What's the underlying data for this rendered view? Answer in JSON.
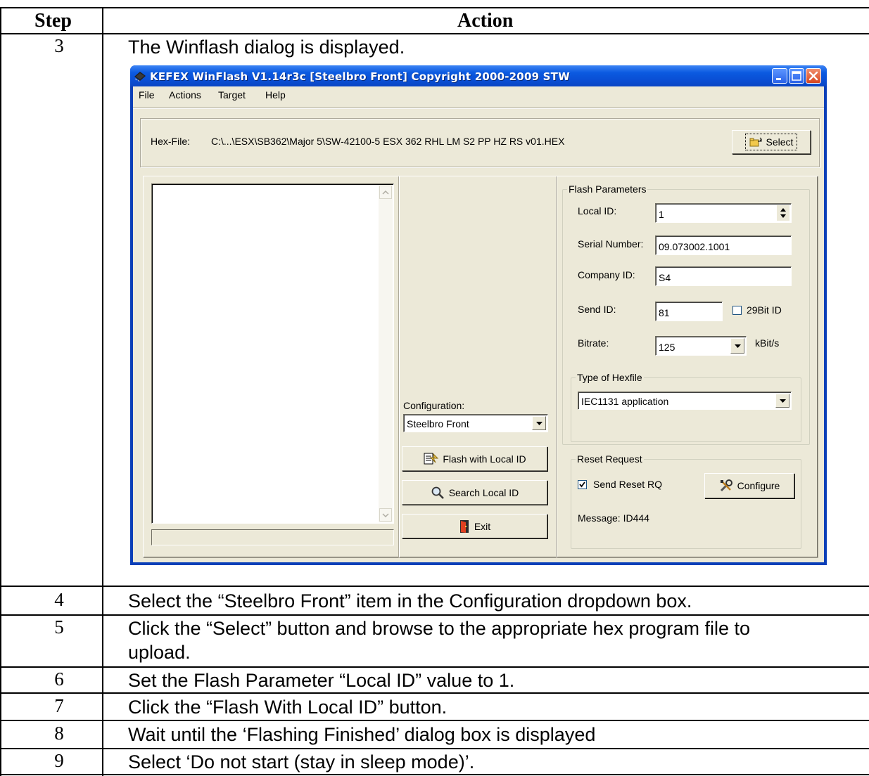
{
  "table": {
    "header": {
      "step": "Step",
      "action": "Action"
    },
    "rows": [
      {
        "step": "3",
        "action": "The Winflash dialog is displayed."
      },
      {
        "step": "4",
        "action": "Select the “Steelbro Front” item in the Configuration dropdown box."
      },
      {
        "step": "5",
        "action": "Click the “Select” button and browse to the appropriate hex program file to",
        "action_cont": "upload."
      },
      {
        "step": "6",
        "action": "Set the Flash Parameter “Local ID” value to 1."
      },
      {
        "step": "7",
        "action": "Click the “Flash With Local ID” button."
      },
      {
        "step": "8",
        "action": "Wait until the ‘Flashing Finished’ dialog box is displayed"
      },
      {
        "step": "9",
        "action": "Select ‘Do not start (stay in sleep mode)’."
      }
    ]
  },
  "window": {
    "title": "KEFEX WinFlash V1.14r3c [Steelbro Front]  Copyright 2000-2009 STW",
    "menu": [
      "File",
      "Actions",
      "Target",
      "Help"
    ],
    "hex_file_label": "Hex-File:",
    "hex_file_path": "C:\\...\\ESX\\SB362\\Major 5\\SW-42100-5 ESX 362 RHL LM S2 PP HZ RS v01.HEX",
    "select_button": "Select",
    "configuration_label": "Configuration:",
    "configuration_value": "Steelbro Front",
    "flash_button": "Flash with Local ID",
    "search_button": "Search Local ID",
    "exit_button": "Exit",
    "flash_params": {
      "title": "Flash Parameters",
      "local_id_label": "Local ID:",
      "local_id_value": "1",
      "serial_label": "Serial Number:",
      "serial_value": "09.073002.1001",
      "company_label": "Company ID:",
      "company_value": "S4",
      "send_id_label": "Send ID:",
      "send_id_value": "81",
      "bit29_label": "29Bit ID",
      "bit29_checked": false,
      "bitrate_label": "Bitrate:",
      "bitrate_value": "125",
      "bitrate_unit": "kBit/s"
    },
    "hexfile_type": {
      "title": "Type of Hexfile",
      "value": "IEC1131 application"
    },
    "reset_request": {
      "title": "Reset Request",
      "send_reset_label": "Send Reset RQ",
      "send_reset_checked": true,
      "configure_button": "Configure",
      "message": "Message: ID444"
    },
    "colors": {
      "titlebar": "#0a4ed4",
      "face": "#ece9d8",
      "close": "#d8461f"
    }
  }
}
